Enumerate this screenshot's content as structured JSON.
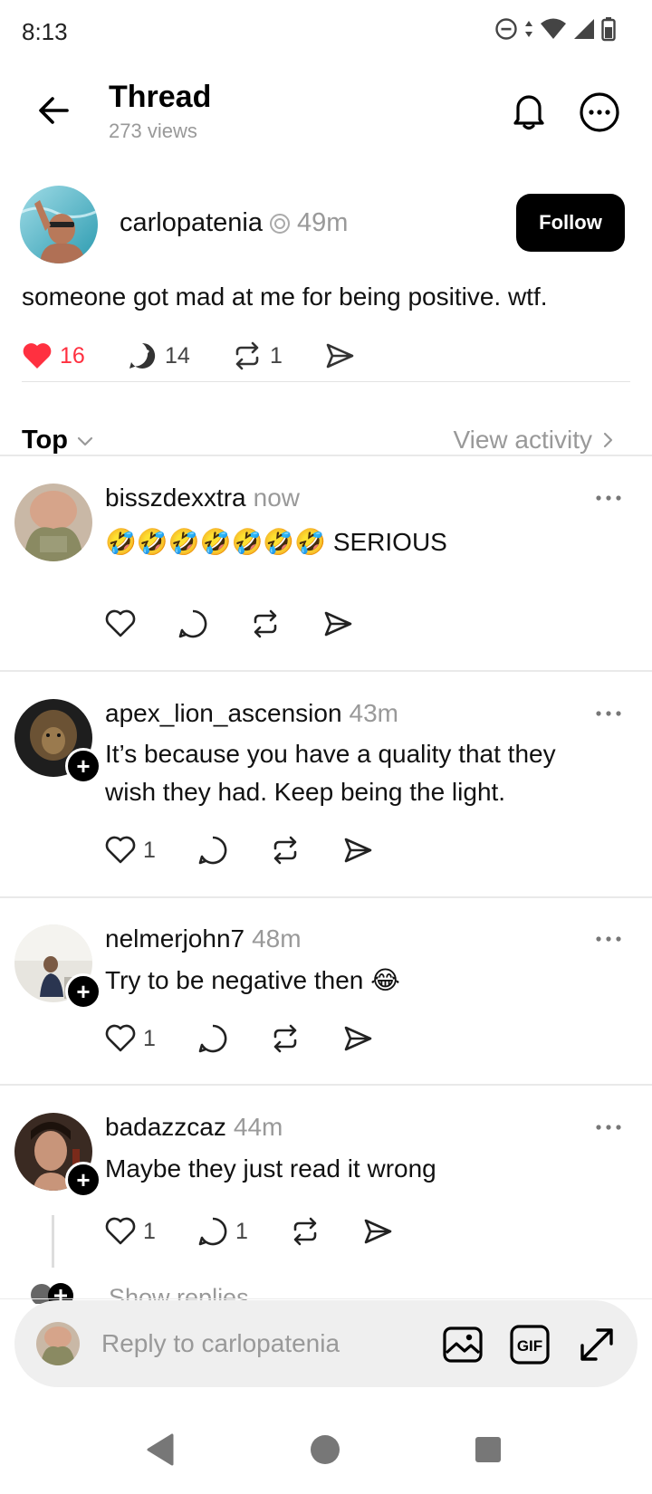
{
  "status": {
    "time": "8:13"
  },
  "header": {
    "title": "Thread",
    "views": "273 views"
  },
  "post": {
    "username": "carlopatenia",
    "time": "49m",
    "follow_label": "Follow",
    "text": "someone got mad at me for being positive. wtf.",
    "likes": "16",
    "comments": "14",
    "reposts": "1"
  },
  "sort": {
    "label": "Top",
    "view_activity": "View activity"
  },
  "replies": [
    {
      "username": "bisszdexxtra",
      "time": "now",
      "text": "🤣🤣🤣🤣🤣🤣🤣 SERIOUS",
      "likes": "",
      "comments": ""
    },
    {
      "username": "apex_lion_ascension",
      "time": "43m",
      "text": "It’s because you have a quality that they wish they had. Keep being the light.",
      "likes": "1",
      "comments": ""
    },
    {
      "username": "nelmerjohn7",
      "time": "48m",
      "text": "Try to be negative then 😂",
      "likes": "1",
      "comments": ""
    },
    {
      "username": "badazzcaz",
      "time": "44m",
      "text": "Maybe they just read it wrong",
      "likes": "1",
      "comments": "1"
    }
  ],
  "show_replies": "Show replies",
  "composer": {
    "placeholder": "Reply to carlopatenia"
  },
  "colors": {
    "like_red": "#ff3040",
    "muted": "#999999"
  }
}
